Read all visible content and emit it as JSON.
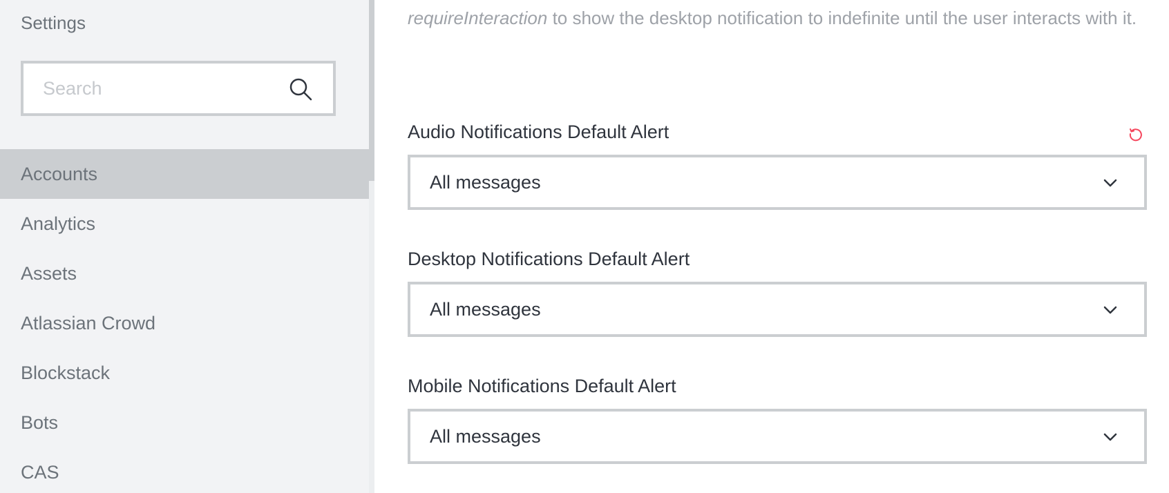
{
  "sidebar": {
    "title": "Settings",
    "search": {
      "placeholder": "Search",
      "value": ""
    },
    "items": [
      {
        "label": "Accounts",
        "active": true
      },
      {
        "label": "Analytics"
      },
      {
        "label": "Assets"
      },
      {
        "label": "Atlassian Crowd"
      },
      {
        "label": "Blockstack"
      },
      {
        "label": "Bots"
      },
      {
        "label": "CAS"
      }
    ]
  },
  "main": {
    "description": {
      "code": "requireInteraction",
      "text": " to show the desktop notification to indefinite until the user interacts with it."
    },
    "settings": [
      {
        "label": "Audio Notifications Default Alert",
        "value": "All messages"
      },
      {
        "label": "Desktop Notifications Default Alert",
        "value": "All messages"
      },
      {
        "label": "Mobile Notifications Default Alert",
        "value": "All messages"
      }
    ]
  },
  "colors": {
    "reset_icon": "#f5455c",
    "active_item_bg": "#cbced1",
    "sidebar_bg": "#f2f3f5"
  },
  "icons": {
    "search": "search-icon",
    "reset": "reset-icon",
    "dropdown": "chevron-down-icon"
  }
}
